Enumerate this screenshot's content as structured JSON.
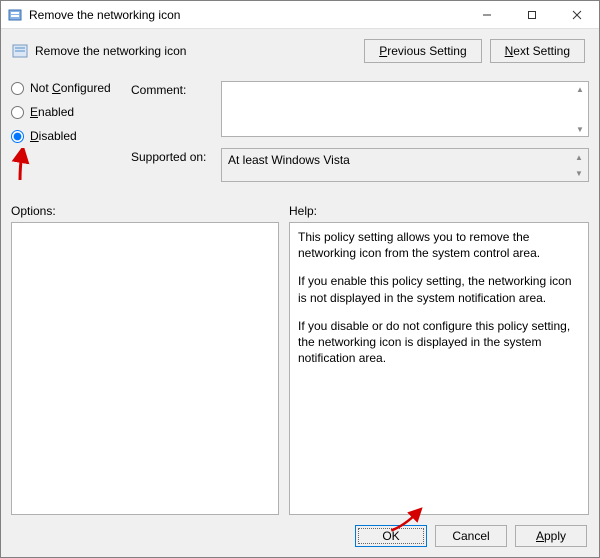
{
  "window": {
    "title": "Remove the networking icon"
  },
  "subheader": {
    "title": "Remove the networking icon"
  },
  "nav": {
    "previous": "Previous Setting",
    "previous_u": "P",
    "next": "Next Setting",
    "next_u": "N"
  },
  "radios": {
    "not_configured": "Not Configured",
    "not_configured_u": "C",
    "enabled": "Enabled",
    "enabled_u": "E",
    "disabled": "Disabled",
    "disabled_u": "D",
    "selected": "disabled"
  },
  "labels": {
    "comment": "Comment:",
    "supported": "Supported on:",
    "options": "Options:",
    "help": "Help:"
  },
  "fields": {
    "comment_value": "",
    "supported_value": "At least Windows Vista"
  },
  "help": {
    "p1": "This policy setting allows you to remove the networking icon from the system control area.",
    "p2": "If you enable this policy setting, the networking icon is not displayed in the system notification area.",
    "p3": "If you disable or do not configure this policy setting, the networking icon is displayed in the system notification area."
  },
  "footer": {
    "ok": "OK",
    "cancel": "Cancel",
    "apply": "Apply",
    "apply_u": "A"
  }
}
